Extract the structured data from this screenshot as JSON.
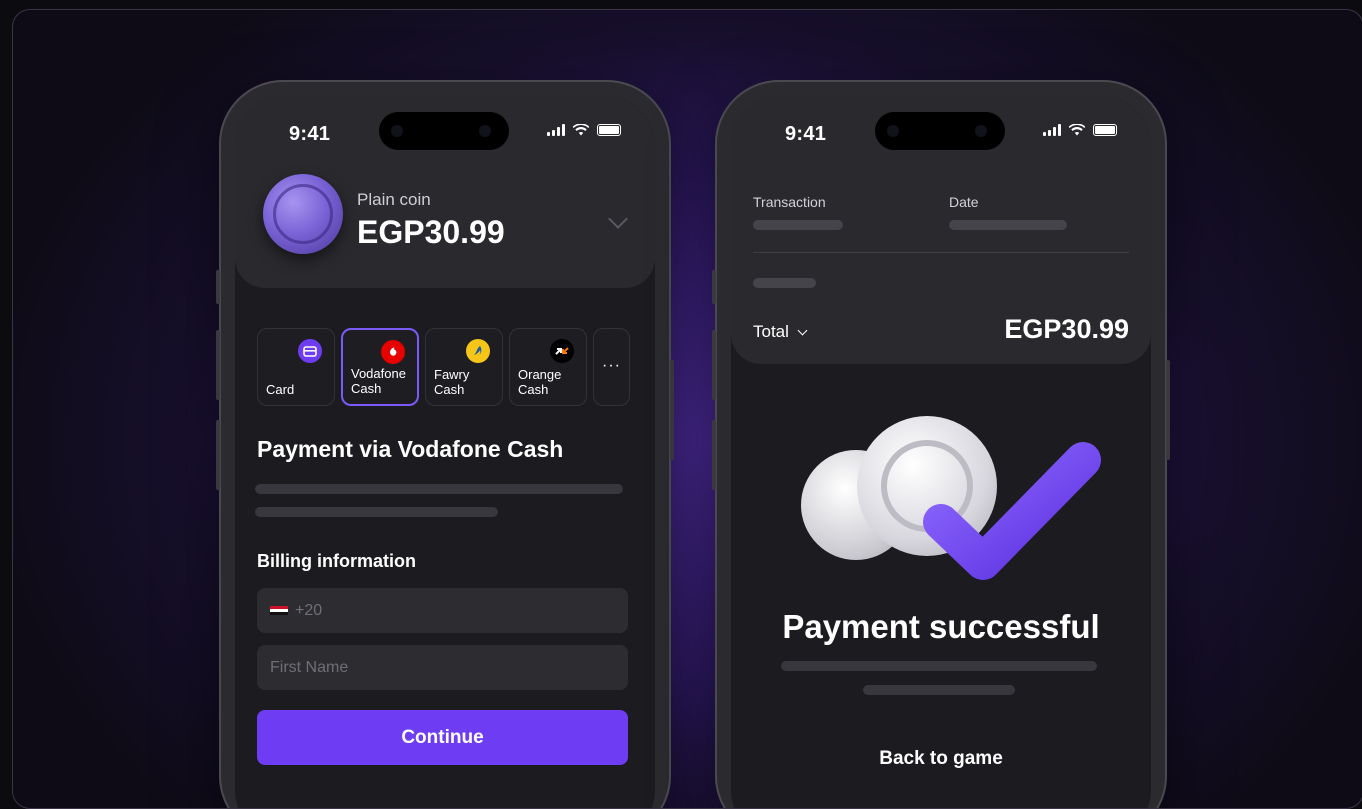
{
  "status": {
    "time": "9:41"
  },
  "checkout": {
    "product_name": "Plain coin",
    "product_price": "EGP30.99",
    "methods": [
      {
        "label": "Card",
        "icon": "card-icon"
      },
      {
        "label": "Vodafone Cash",
        "icon": "vodafone-icon",
        "selected": true
      },
      {
        "label": "Fawry Cash",
        "icon": "fawry-icon"
      },
      {
        "label": "Orange Cash",
        "icon": "orange-cash-icon"
      },
      {
        "label": "",
        "icon": "more-icon"
      }
    ],
    "heading": "Payment via Vodafone Cash",
    "billing_heading": "Billing information",
    "phone_placeholder": "+20",
    "first_name_placeholder": "First Name",
    "continue_label": "Continue"
  },
  "receipt": {
    "transaction_label": "Transaction",
    "date_label": "Date",
    "total_label": "Total",
    "total_value": "EGP30.99",
    "title": "Payment successful",
    "back_label": "Back to game"
  },
  "colors": {
    "accent": "#6e3df3",
    "vodafone": "#e60000",
    "fawry": "#f5c518",
    "orange": "#ff7900"
  }
}
